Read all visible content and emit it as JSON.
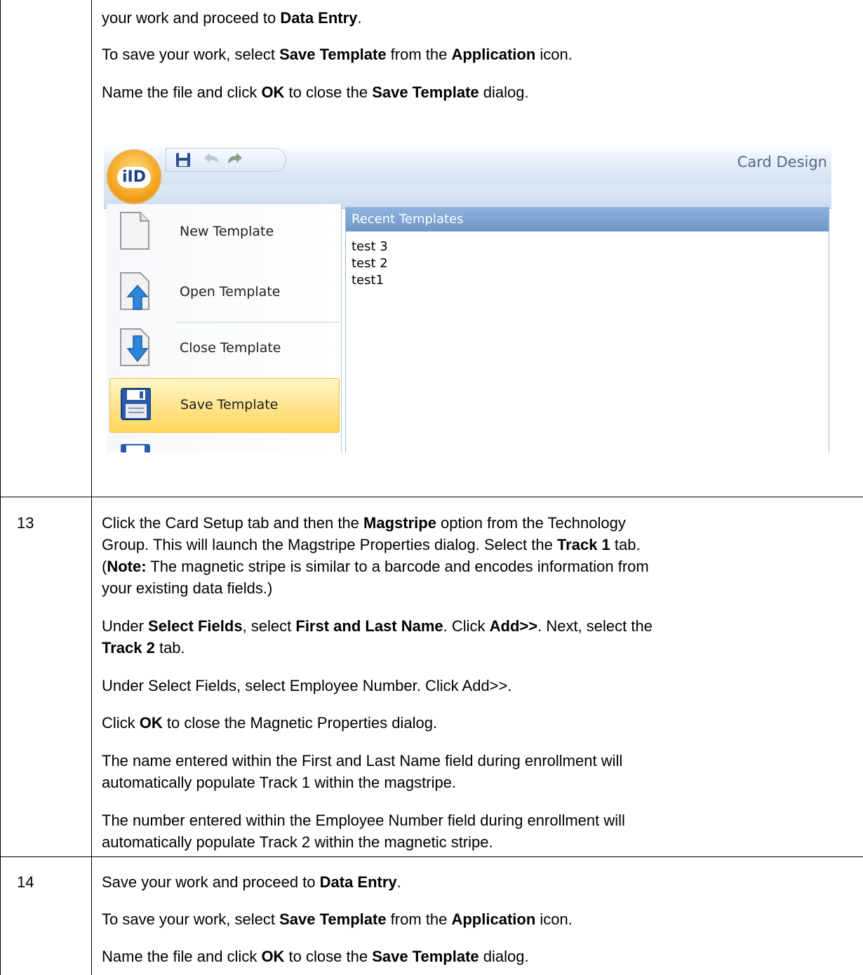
{
  "rows": [
    {
      "number": "",
      "paragraphs": [
        [
          {
            "t": "your work and proceed to "
          },
          {
            "t": "Data Entry",
            "b": true
          },
          {
            "t": "."
          }
        ],
        [
          {
            "t": "To save your work, select "
          },
          {
            "t": "Save Template",
            "b": true
          },
          {
            "t": " from the "
          },
          {
            "t": "Application",
            "b": true
          },
          {
            "t": " icon."
          }
        ],
        [
          {
            "t": "Name the file and click "
          },
          {
            "t": "OK",
            "b": true
          },
          {
            "t": " to close the "
          },
          {
            "t": "Save Template",
            "b": true
          },
          {
            "t": " dialog."
          }
        ]
      ]
    },
    {
      "number": "13",
      "paragraphs": [
        [
          {
            "t": "Click the Card Setup tab and then the "
          },
          {
            "t": "Magstripe",
            "b": true
          },
          {
            "t": " option from the Technology"
          }
        ],
        [
          {
            "t": "Group. This will launch the Magstripe Properties dialog. Select the "
          },
          {
            "t": "Track 1",
            "b": true
          },
          {
            "t": " tab."
          }
        ],
        [
          {
            "t": "("
          },
          {
            "t": "Note:",
            "b": true
          },
          {
            "t": "  The magnetic stripe is similar to a barcode and encodes information from"
          }
        ],
        [
          {
            "t": "your existing data fields.)"
          }
        ],
        [
          {
            "t": "Under "
          },
          {
            "t": "Select Fields",
            "b": true
          },
          {
            "t": ", select "
          },
          {
            "t": "First and Last Name",
            "b": true
          },
          {
            "t": ". Click "
          },
          {
            "t": "Add>>",
            "b": true
          },
          {
            "t": ". Next, select the"
          }
        ],
        [
          {
            "t": "Track 2",
            "b": true
          },
          {
            "t": " tab."
          }
        ],
        [
          {
            "t": "Under Select Fields, select Employee Number. Click Add>>."
          }
        ],
        [
          {
            "t": "Click "
          },
          {
            "t": "OK",
            "b": true
          },
          {
            "t": " to close the Magnetic Properties dialog."
          }
        ],
        [
          {
            "t": "The name entered within the First and Last Name field during enrollment will"
          }
        ],
        [
          {
            "t": "automatically populate Track 1 within the magstripe."
          }
        ],
        [
          {
            "t": "The number entered within the Employee Number field during enrollment will"
          }
        ],
        [
          {
            "t": "automatically populate Track 2 within the magnetic stripe."
          }
        ]
      ]
    },
    {
      "number": "14",
      "paragraphs": [
        [
          {
            "t": "Save your work and proceed to "
          },
          {
            "t": "Data Entry",
            "b": true
          },
          {
            "t": "."
          }
        ],
        [
          {
            "t": "To save your work, select "
          },
          {
            "t": "Save Template",
            "b": true
          },
          {
            "t": " from the "
          },
          {
            "t": "Application",
            "b": true
          },
          {
            "t": " icon."
          }
        ],
        [
          {
            "t": "Name the file and click "
          },
          {
            "t": "OK",
            "b": true
          },
          {
            "t": " to close the "
          },
          {
            "t": "Save Template",
            "b": true
          },
          {
            "t": " dialog."
          }
        ]
      ]
    }
  ],
  "screenshot": {
    "window_title": "Card Design",
    "app_logo": "iID",
    "quick_access_icons": [
      "save-icon",
      "undo-icon",
      "redo-icon"
    ],
    "menu_items": [
      "New Template",
      "Open Template",
      "Close Template",
      "Save Template"
    ],
    "active_item": "Save Template",
    "recent_header": "Recent Templates",
    "recent_items": [
      "test 3",
      "test 2",
      "test1"
    ],
    "accent_color": "#ffd75a",
    "header_color": "#6f96c8"
  }
}
